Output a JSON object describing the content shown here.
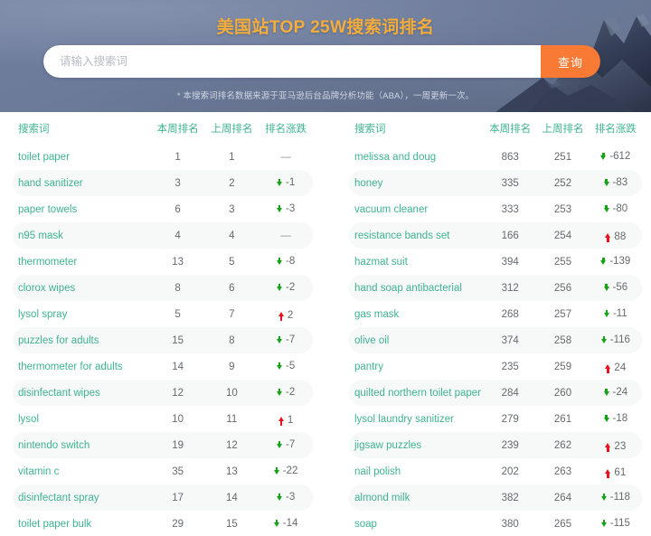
{
  "hero": {
    "title": "美国站TOP 25W搜索词排名",
    "note": "* 本搜索词排名数据来源于亚马逊后台品牌分析功能（ABA），一周更新一次。",
    "search": {
      "placeholder": "请输入搜索词",
      "value": "",
      "button_label": "查询"
    },
    "colors": {
      "background": "#6b7a99",
      "title": "#f3ad3d",
      "button": "#f97a34"
    }
  },
  "table": {
    "headers": {
      "term": "搜索词",
      "this_week": "本周排名",
      "last_week": "上周排名",
      "change": "排名涨跌"
    },
    "colors": {
      "link": "#3fb392",
      "down": "#14a314",
      "up": "#e8141b",
      "stripe": "#f7f8f8"
    },
    "no_change_symbol": "—"
  },
  "left_rows": [
    {
      "term": "toilet paper",
      "this_week": "1",
      "last_week": "1",
      "change": "—",
      "dir": "none"
    },
    {
      "term": "hand sanitizer",
      "this_week": "3",
      "last_week": "2",
      "change": "-1",
      "dir": "down"
    },
    {
      "term": "paper towels",
      "this_week": "6",
      "last_week": "3",
      "change": "-3",
      "dir": "down"
    },
    {
      "term": "n95 mask",
      "this_week": "4",
      "last_week": "4",
      "change": "—",
      "dir": "none"
    },
    {
      "term": "thermometer",
      "this_week": "13",
      "last_week": "5",
      "change": "-8",
      "dir": "down"
    },
    {
      "term": "clorox wipes",
      "this_week": "8",
      "last_week": "6",
      "change": "-2",
      "dir": "down"
    },
    {
      "term": "lysol spray",
      "this_week": "5",
      "last_week": "7",
      "change": "2",
      "dir": "up"
    },
    {
      "term": "puzzles for adults",
      "this_week": "15",
      "last_week": "8",
      "change": "-7",
      "dir": "down"
    },
    {
      "term": "thermometer for adults",
      "this_week": "14",
      "last_week": "9",
      "change": "-5",
      "dir": "down"
    },
    {
      "term": "disinfectant wipes",
      "this_week": "12",
      "last_week": "10",
      "change": "-2",
      "dir": "down"
    },
    {
      "term": "lysol",
      "this_week": "10",
      "last_week": "11",
      "change": "1",
      "dir": "up"
    },
    {
      "term": "nintendo switch",
      "this_week": "19",
      "last_week": "12",
      "change": "-7",
      "dir": "down"
    },
    {
      "term": "vitamin c",
      "this_week": "35",
      "last_week": "13",
      "change": "-22",
      "dir": "down"
    },
    {
      "term": "disinfectant spray",
      "this_week": "17",
      "last_week": "14",
      "change": "-3",
      "dir": "down"
    },
    {
      "term": "toilet paper bulk",
      "this_week": "29",
      "last_week": "15",
      "change": "-14",
      "dir": "down"
    }
  ],
  "right_rows": [
    {
      "term": "melissa and doug",
      "this_week": "863",
      "last_week": "251",
      "change": "-612",
      "dir": "down"
    },
    {
      "term": "honey",
      "this_week": "335",
      "last_week": "252",
      "change": "-83",
      "dir": "down"
    },
    {
      "term": "vacuum cleaner",
      "this_week": "333",
      "last_week": "253",
      "change": "-80",
      "dir": "down"
    },
    {
      "term": "resistance bands set",
      "this_week": "166",
      "last_week": "254",
      "change": "88",
      "dir": "up"
    },
    {
      "term": "hazmat suit",
      "this_week": "394",
      "last_week": "255",
      "change": "-139",
      "dir": "down"
    },
    {
      "term": "hand soap antibacterial",
      "this_week": "312",
      "last_week": "256",
      "change": "-56",
      "dir": "down"
    },
    {
      "term": "gas mask",
      "this_week": "268",
      "last_week": "257",
      "change": "-11",
      "dir": "down"
    },
    {
      "term": "olive oil",
      "this_week": "374",
      "last_week": "258",
      "change": "-116",
      "dir": "down"
    },
    {
      "term": "pantry",
      "this_week": "235",
      "last_week": "259",
      "change": "24",
      "dir": "up"
    },
    {
      "term": "quilted northern toilet paper",
      "this_week": "284",
      "last_week": "260",
      "change": "-24",
      "dir": "down"
    },
    {
      "term": "lysol laundry sanitizer",
      "this_week": "279",
      "last_week": "261",
      "change": "-18",
      "dir": "down"
    },
    {
      "term": "jigsaw puzzles",
      "this_week": "239",
      "last_week": "262",
      "change": "23",
      "dir": "up"
    },
    {
      "term": "nail polish",
      "this_week": "202",
      "last_week": "263",
      "change": "61",
      "dir": "up"
    },
    {
      "term": "almond milk",
      "this_week": "382",
      "last_week": "264",
      "change": "-118",
      "dir": "down"
    },
    {
      "term": "soap",
      "this_week": "380",
      "last_week": "265",
      "change": "-115",
      "dir": "down"
    }
  ]
}
